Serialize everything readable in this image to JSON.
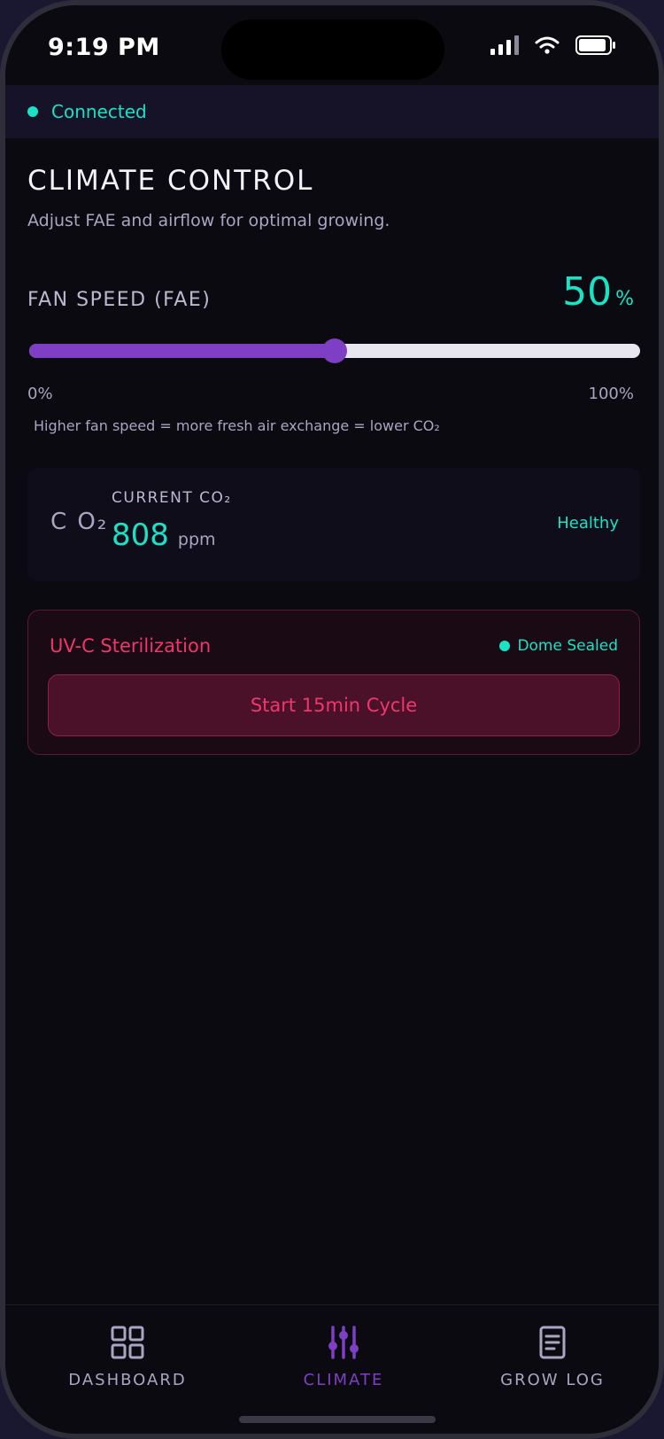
{
  "status_bar": {
    "time": "9:19 PM"
  },
  "connection": {
    "label": "Connected"
  },
  "page": {
    "title": "CLIMATE CONTROL",
    "subtitle": "Adjust FAE and airflow for optimal growing."
  },
  "fan": {
    "label": "FAN SPEED (FAE)",
    "value": "50",
    "unit": "%",
    "level": 0.5,
    "min_label": "0%",
    "max_label": "100%",
    "hint": "Higher fan speed = more fresh air exchange = lower CO₂"
  },
  "co2": {
    "icon": "co2-icon",
    "icon_text": "C O₂",
    "label": "CURRENT CO₂",
    "value": "808",
    "unit": "ppm",
    "status": "Healthy"
  },
  "uv": {
    "title": "UV-C Sterilization",
    "status": "Dome Sealed",
    "button_label": "Start 15min Cycle"
  },
  "nav": {
    "items": [
      {
        "label": "DASHBOARD",
        "icon": "grid-icon"
      },
      {
        "label": "CLIMATE",
        "icon": "sliders-icon",
        "active": true
      },
      {
        "label": "GROW LOG",
        "icon": "document-icon"
      }
    ]
  },
  "colors": {
    "accent": "#19e2c5",
    "purple": "#7e3fc4",
    "danger": "#f0366c",
    "background": "#0b0a10"
  }
}
